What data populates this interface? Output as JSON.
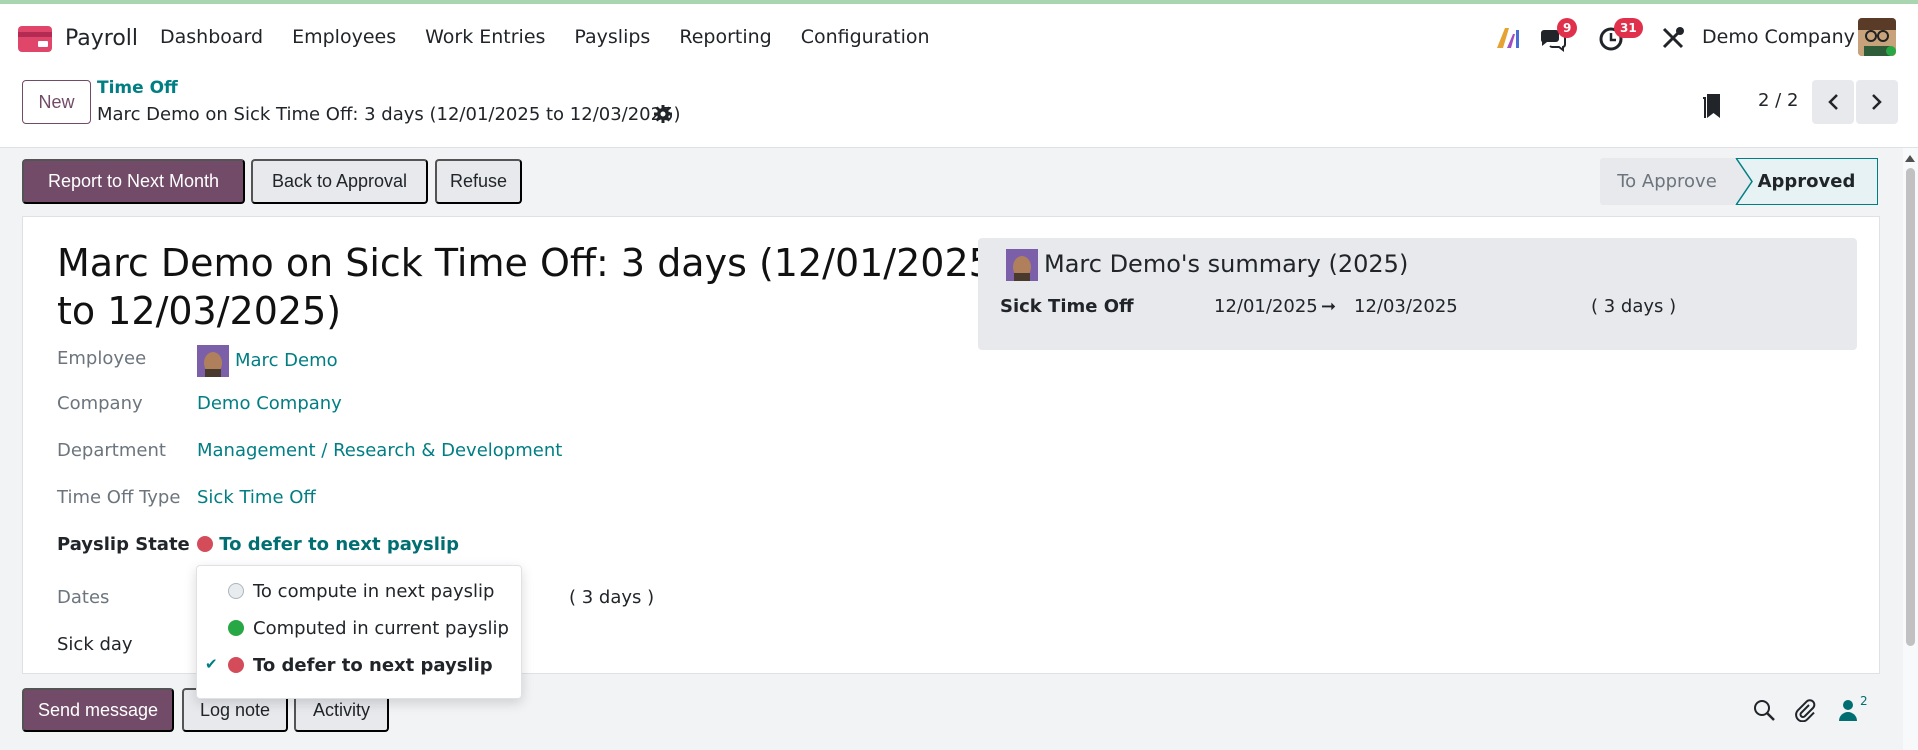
{
  "nav": {
    "app_name": "Payroll",
    "menu": [
      "Dashboard",
      "Employees",
      "Work Entries",
      "Payslips",
      "Reporting",
      "Configuration"
    ],
    "messages_badge": "9",
    "activities_badge": "31",
    "company": "Demo Company"
  },
  "control_panel": {
    "new_label": "New",
    "breadcrumb_parent": "Time Off",
    "breadcrumb_current": "Marc Demo on Sick Time Off: 3 days (12/01/2025 to 12/03/2025)",
    "pager": "2 / 2"
  },
  "statusbar": {
    "buttons": [
      "Report to Next Month",
      "Back to Approval",
      "Refuse"
    ],
    "stages": [
      "To Approve",
      "Approved"
    ],
    "active_stage": "Approved"
  },
  "form": {
    "title": "Marc Demo on Sick Time Off: 3 days (12/01/2025 to 12/03/2025)",
    "fields": {
      "employee_label": "Employee",
      "employee_value": "Marc Demo",
      "company_label": "Company",
      "company_value": "Demo Company",
      "department_label": "Department",
      "department_value": "Management / Research & Development",
      "type_label": "Time Off Type",
      "type_value": "Sick Time Off",
      "payslip_state_label": "Payslip State",
      "payslip_state_value": "To defer to next payslip",
      "dates_label": "Dates",
      "dates_duration": "( 3 days )",
      "sick_day_label": "Sick day"
    },
    "summary": {
      "title": "Marc Demo's summary (2025)",
      "type": "Sick Time Off",
      "from": "12/01/2025",
      "arrow": "➞",
      "to": "12/03/2025",
      "duration": "( 3 days )"
    }
  },
  "dropdown": {
    "options": [
      {
        "label": "To compute in next payslip",
        "color": "#e9ecef"
      },
      {
        "label": "Computed in current payslip",
        "color": "#28a745"
      },
      {
        "label": "To defer to next payslip",
        "color": "#d44c59"
      }
    ],
    "check": "✔"
  },
  "chatter": {
    "send_message": "Send message",
    "log_note": "Log note",
    "activity": "Activity",
    "followers_count": "2"
  },
  "colors": {
    "primary": "#714b67",
    "link": "#017e84",
    "badge": "#e0304c"
  }
}
